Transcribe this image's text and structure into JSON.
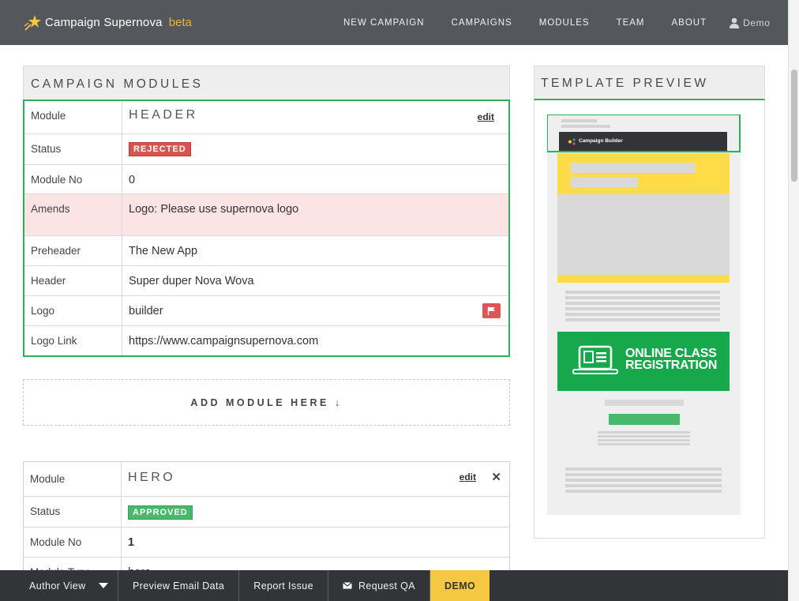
{
  "nav": {
    "brand_name": "Campaign Supernova",
    "brand_tag": "beta",
    "items": [
      "NEW CAMPAIGN",
      "CAMPAIGNS",
      "MODULES",
      "TEAM",
      "ABOUT"
    ],
    "user": "Demo"
  },
  "modules_panel": {
    "title": "CAMPAIGN MODULES"
  },
  "module_header": {
    "rows": {
      "module_label": "Module",
      "module_value": "HEADER",
      "edit": "edit",
      "status_label": "Status",
      "status_value": "REJECTED",
      "moduleno_label": "Module No",
      "moduleno_value": "0",
      "amends_label": "Amends",
      "amends_value": "Logo: Please use supernova logo",
      "preheader_label": "Preheader",
      "preheader_value": "The New App",
      "header_label": "Header",
      "header_value": "Super duper Nova Wova",
      "logo_label": "Logo",
      "logo_value": "builder",
      "logolink_label": "Logo Link",
      "logolink_value": "https://www.campaignsupernova.com"
    }
  },
  "add_module": "ADD MODULE HERE ↓",
  "module_hero": {
    "rows": {
      "module_label": "Module",
      "module_value": "HERO",
      "edit": "edit",
      "status_label": "Status",
      "status_value": "APPROVED",
      "moduleno_label": "Module No",
      "moduleno_value": "1",
      "moduletype_label": "Module Type",
      "moduletype_value": "hero"
    }
  },
  "template_preview": {
    "title": "TEMPLATE PREVIEW",
    "email_brand": "Campaign Builder",
    "cta_line1": "ONLINE CLASS",
    "cta_line2": "REGISTRATION"
  },
  "bottom_bar": {
    "view": "Author View",
    "preview": "Preview Email Data",
    "report": "Report Issue",
    "qa": "Request QA",
    "demo": "DEMO"
  },
  "colors": {
    "nav_bg": "#54575b",
    "accent_green": "#2bb15a",
    "beta_orange": "#f0b33a",
    "rejected_red": "#d9534f",
    "approved_green": "#49b86a",
    "demo_yellow": "#f5c842"
  }
}
